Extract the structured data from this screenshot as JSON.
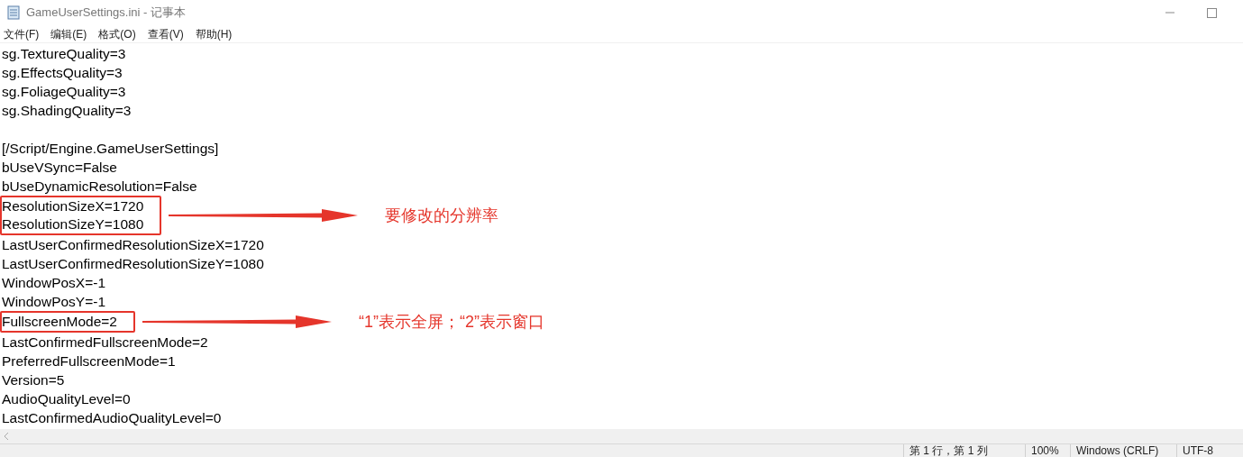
{
  "window": {
    "title": "GameUserSettings.ini - 记事本"
  },
  "menu": [
    "文件(F)",
    "编辑(E)",
    "格式(O)",
    "查看(V)",
    "帮助(H)"
  ],
  "lines": [
    {
      "kind": "text",
      "text": "sg.TextureQuality=3"
    },
    {
      "kind": "text",
      "text": "sg.EffectsQuality=3"
    },
    {
      "kind": "text",
      "text": "sg.FoliageQuality=3"
    },
    {
      "kind": "text",
      "text": "sg.ShadingQuality=3"
    },
    {
      "kind": "blank"
    },
    {
      "kind": "text",
      "text": "[/Script/Engine.GameUserSettings]"
    },
    {
      "kind": "text",
      "text": "bUseVSync=False"
    },
    {
      "kind": "text",
      "text": "bUseDynamicResolution=False"
    },
    {
      "kind": "boxed",
      "lines": [
        "ResolutionSizeX=1720",
        "ResolutionSizeY=1080"
      ],
      "note": "要修改的分辨率"
    },
    {
      "kind": "text",
      "text": "LastUserConfirmedResolutionSizeX=1720"
    },
    {
      "kind": "text",
      "text": "LastUserConfirmedResolutionSizeY=1080"
    },
    {
      "kind": "text",
      "text": "WindowPosX=-1"
    },
    {
      "kind": "text",
      "text": "WindowPosY=-1"
    },
    {
      "kind": "boxed",
      "lines": [
        "FullscreenMode=2"
      ],
      "note": "“1”表示全屏；“2”表示窗口"
    },
    {
      "kind": "text",
      "text": "LastConfirmedFullscreenMode=2"
    },
    {
      "kind": "text",
      "text": "PreferredFullscreenMode=1"
    },
    {
      "kind": "text",
      "text": "Version=5"
    },
    {
      "kind": "text",
      "text": "AudioQualityLevel=0"
    },
    {
      "kind": "text",
      "text": "LastConfirmedAudioQualityLevel=0"
    }
  ],
  "status_bar": [
    "第 1 行，第 1 列",
    "100%",
    "Windows (CRLF)",
    "UTF-8"
  ]
}
